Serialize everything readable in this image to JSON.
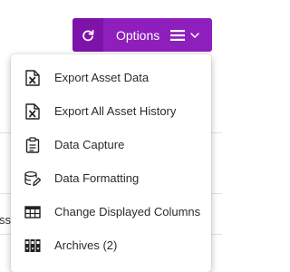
{
  "toolbar": {
    "options_label": "Options",
    "accent_color": "#8e1fbc"
  },
  "menu": {
    "items": [
      {
        "label": "Export Asset Data",
        "icon": "excel-file-icon"
      },
      {
        "label": "Export All Asset History",
        "icon": "excel-file-icon"
      },
      {
        "label": "Data Capture",
        "icon": "clipboard-icon"
      },
      {
        "label": "Data Formatting",
        "icon": "database-edit-icon"
      },
      {
        "label": "Change Displayed Columns",
        "icon": "table-columns-icon"
      },
      {
        "label": "Archives (2)",
        "icon": "archive-binders-icon"
      }
    ]
  },
  "background": {
    "cut_text": "ss"
  }
}
